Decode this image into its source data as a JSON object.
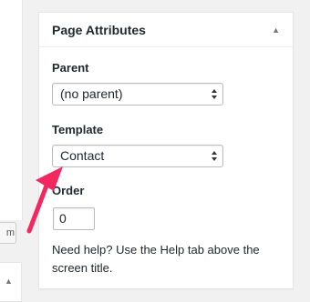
{
  "left_panel": {
    "button_text": "m"
  },
  "metabox": {
    "title": "Page Attributes",
    "parent": {
      "label": "Parent",
      "selected": "(no parent)"
    },
    "template": {
      "label": "Template",
      "selected": "Contact"
    },
    "order": {
      "label": "Order",
      "value": "0"
    },
    "help": "Need help? Use the Help tab above the screen title."
  },
  "annotation": {
    "arrow_color": "#f2285f"
  }
}
